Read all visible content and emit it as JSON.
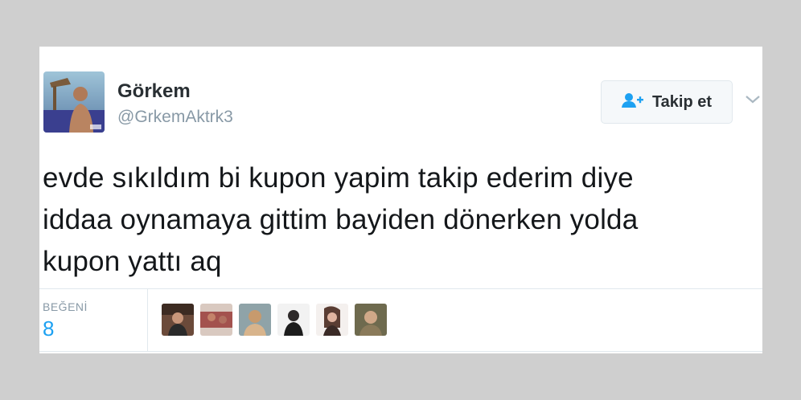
{
  "user": {
    "display_name": "Görkem",
    "handle": "@GrkemAktrk3",
    "avatar_icon": "profile-photo"
  },
  "follow_button": {
    "label": "Takip et",
    "icon": "add-user-icon",
    "accent": "#1da1f2"
  },
  "menu_icon": "chevron-down-icon",
  "tweet": {
    "lines": [
      "evde sıkıldım bi kupon yapim takip ederim diye",
      "iddaa oynamaya gittim bayiden dönerken yolda",
      "kupon yattı aq"
    ]
  },
  "stats": {
    "likes_label": "BEĞENİ",
    "likes_count": "8",
    "likers": [
      {
        "icon": "liker-avatar-1",
        "color": "#6b4a3a"
      },
      {
        "icon": "liker-avatar-2",
        "color": "#a3524e"
      },
      {
        "icon": "liker-avatar-3",
        "color": "#c79a6d"
      },
      {
        "icon": "liker-avatar-4",
        "color": "#2e2a2a"
      },
      {
        "icon": "liker-avatar-5",
        "color": "#5a3d33"
      },
      {
        "icon": "liker-avatar-6",
        "color": "#8a7a5a"
      }
    ]
  }
}
